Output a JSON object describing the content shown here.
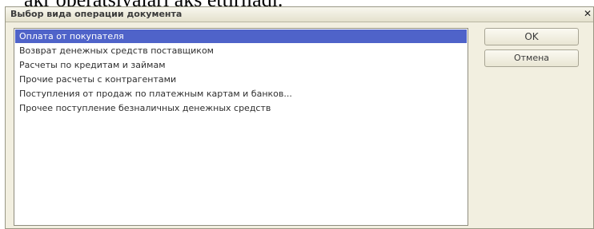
{
  "background_text": "akr operatsiyalari aks ettiriladi.",
  "dialog": {
    "title": "Выбор вида операции документа",
    "close_label": "✕"
  },
  "list": {
    "items": [
      {
        "label": "Оплата от покупателя",
        "selected": true
      },
      {
        "label": "Возврат денежных средств поставщиком",
        "selected": false
      },
      {
        "label": "Расчеты по кредитам и займам",
        "selected": false
      },
      {
        "label": "Прочие расчеты с контрагентами",
        "selected": false
      },
      {
        "label": "Поступления от продаж по платежным картам и банков...",
        "selected": false
      },
      {
        "label": "Прочее поступление безналичных денежных средств",
        "selected": false
      }
    ]
  },
  "buttons": {
    "ok_label": "OK",
    "cancel_label": "Отмена"
  },
  "colors": {
    "selection": "#4f63c9",
    "dialog_background": "#f2efe0"
  }
}
